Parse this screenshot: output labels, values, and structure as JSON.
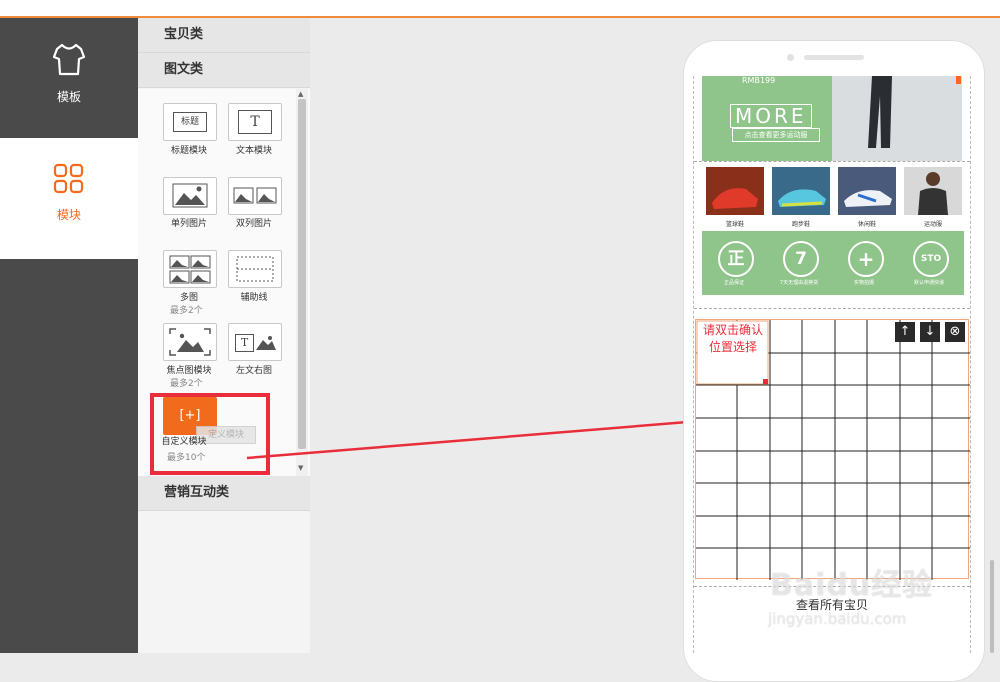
{
  "nav": {
    "template_label": "模板",
    "module_label": "模块",
    "accent": "#f26b1d"
  },
  "panel": {
    "section_baby": "宝贝类",
    "section_imgtext": "图文类",
    "section_marketing": "营销互动类",
    "tiles": {
      "title_module": {
        "icon_text": "标题",
        "label": "标题模块"
      },
      "text_module": {
        "icon_text": "T",
        "label": "文本模块"
      },
      "single_image": {
        "label": "单列图片"
      },
      "double_image": {
        "label": "双列图片"
      },
      "multi_image": {
        "label": "多图",
        "sub": "最多2个"
      },
      "guide_line": {
        "label": "辅助线"
      },
      "focus_image": {
        "label": "焦点图模块",
        "sub": "最多2个"
      },
      "left_text_right_image": {
        "icon_text": "T",
        "label": "左文右图"
      },
      "custom_module": {
        "label": "自定义模块",
        "ghost": "定义模块",
        "sub": "最多10个",
        "icon_text": "[+]"
      }
    }
  },
  "phone": {
    "price_text": "RMB199",
    "more_title": "MORE",
    "more_sub": "点击查看更多运动服",
    "shoe_cats": [
      "篮球鞋",
      "跑步鞋",
      "休闲鞋",
      "运动服"
    ],
    "badges": [
      {
        "icon": "正",
        "text": "正品保证"
      },
      {
        "icon": "7",
        "text": "7天无理由退换货"
      },
      {
        "icon": "+",
        "text": "实物拍摄"
      },
      {
        "icon": "STO",
        "text": "默认申通快递"
      }
    ],
    "grid_hint": "请双击确认位置选择",
    "view_all": "查看所有宝贝"
  },
  "watermark": {
    "brand": "Baidu经验",
    "url": "jingyan.baidu.com"
  },
  "colors": {
    "highlight_red": "#ea2d3a",
    "green_banner": "#8fc48a",
    "custom_orange": "#f26b1d"
  }
}
